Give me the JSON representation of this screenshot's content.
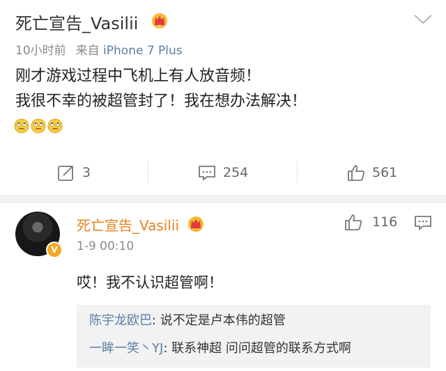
{
  "post": {
    "username": "死亡宣告_Vasilii",
    "time": "10小时前",
    "source_prefix": "来自",
    "source": "iPhone 7 Plus",
    "lines": [
      "刚才游戏过程中飞机上有人放音频！",
      "我很不幸的被超管封了！我在想办法解决！"
    ],
    "emojis": [
      "eye-roll-emoji",
      "eye-roll-emoji",
      "eye-roll-emoji"
    ],
    "actions": {
      "repost_count": "3",
      "comment_count": "254",
      "like_count": "561"
    }
  },
  "comment": {
    "username": "死亡宣告_Vasilii",
    "time": "1-9 00:10",
    "like_count": "116",
    "text": "哎！我不认识超管啊！",
    "replies": [
      {
        "name": "陈宇龙欧巴",
        "sep": ": ",
        "text": "说不定是卢本伟的超管"
      },
      {
        "name": "一眸一笑丶YJ",
        "sep": ": ",
        "text": "联系神超 问问超管的联系方式啊"
      }
    ]
  },
  "colors": {
    "link": "#5b7fa6",
    "commenter_name": "#e8821c",
    "muted": "#8a8a8a",
    "badge_gold": "#f5a623"
  }
}
